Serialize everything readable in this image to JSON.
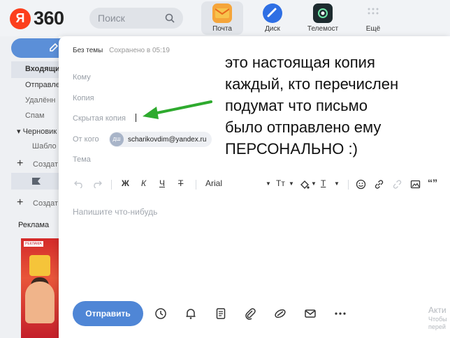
{
  "topbar": {
    "logo_letter": "Я",
    "logo_text": "360",
    "search_placeholder": "Поиск",
    "services": [
      {
        "label": "Почта",
        "icon": "mail-envelope-icon",
        "color": "#f5a53a"
      },
      {
        "label": "Диск",
        "icon": "disk-icon",
        "color": "#2f6fe4"
      },
      {
        "label": "Телемост",
        "icon": "telemost-icon",
        "color": "#1d2b2f"
      },
      {
        "label": "Ещё",
        "icon": "more-grid-icon",
        "color": "#c8ccd2"
      }
    ]
  },
  "sidebar": {
    "items": [
      "Входящи",
      "Отправле",
      "Удалённ",
      "Спам",
      "▾ Черновик",
      "Шабло",
      "Создат",
      "Создат"
    ],
    "ad_label": "Реклама",
    "ad_tag": "РЕКЛАМА"
  },
  "compose": {
    "title": "Без темы",
    "saved": "Сохранено в 05:19",
    "to_label": "Кому",
    "cc_label": "Копия",
    "bcc_label": "Скрытая копия",
    "from_label": "От кого",
    "from_avatar": "ДШ",
    "from_email": "scharikovdim@yandex.ru",
    "subject_label": "Тема",
    "toolbar": {
      "bold": "Ж",
      "italic": "К",
      "underline": "Ч",
      "strike": "Т",
      "font": "Arial",
      "text_size": "Тт",
      "text_color": "Т",
      "quote": "“”"
    },
    "body_placeholder": "Напишите что-нибудь",
    "send_label": "Отправить",
    "activate_title": "Акти",
    "activate_line1": "Чтобы",
    "activate_line2": "перей"
  },
  "annotation": {
    "lines": [
      "это настоящая копия",
      "каждый, кто перечислен",
      "подумат что письмо",
      "было отправлено ему",
      "ПЕРСОНАЛЬНО :)"
    ],
    "arrow_color": "#2eaa2e"
  }
}
